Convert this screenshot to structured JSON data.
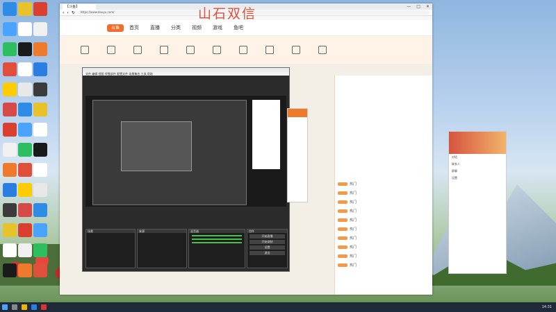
{
  "watermark": "山石双信",
  "browser": {
    "tab_title": "【斗鱼】",
    "url": "https://www.douyu.com/",
    "window_controls": [
      "—",
      "□",
      "✕"
    ]
  },
  "site": {
    "logo": "斗鱼",
    "nav_items": [
      "首页",
      "直播",
      "分类",
      "视频",
      "游戏",
      "鱼吧"
    ],
    "chat_rows": [
      {
        "text": "热门"
      },
      {
        "text": "热门"
      },
      {
        "text": "热门"
      },
      {
        "text": "热门"
      },
      {
        "text": "热门"
      },
      {
        "text": "热门"
      },
      {
        "text": "热门"
      },
      {
        "text": "热门"
      },
      {
        "text": "热门"
      },
      {
        "text": "热门"
      }
    ]
  },
  "obs": {
    "menu": "文件  编辑  视图  停靠部件  配置文件  场景集合  工具  帮助",
    "docks": [
      "场景",
      "来源",
      "混音器",
      "转场",
      "控件"
    ],
    "controls": [
      "开始直播",
      "开始录制",
      "设置",
      "退出"
    ]
  },
  "qq": {
    "items": [
      "对话",
      "联系人",
      "群聊",
      "设置"
    ]
  },
  "taskbar": {
    "time": "14:31"
  }
}
